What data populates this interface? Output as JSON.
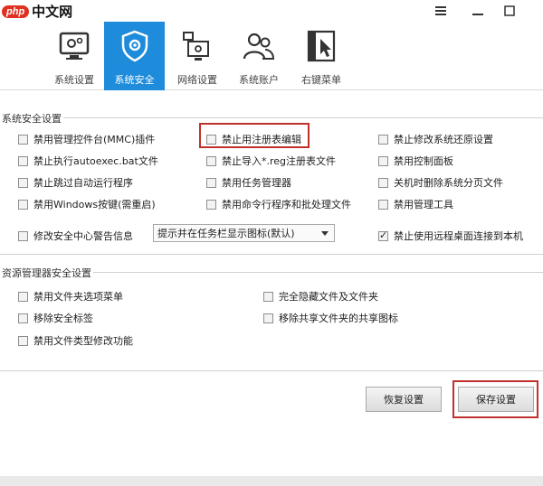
{
  "titlebar": {
    "logo_php": "php",
    "logo_cn": "中文网",
    "menu_icon": "≡",
    "minimize_icon": "—",
    "maximize_icon": "□"
  },
  "toolbar": {
    "items": [
      {
        "label": "系统设置",
        "icon": "computer-gear-icon"
      },
      {
        "label": "系统安全",
        "icon": "shield-gear-icon",
        "active": true
      },
      {
        "label": "网络设置",
        "icon": "network-icon"
      },
      {
        "label": "系统账户",
        "icon": "users-icon"
      },
      {
        "label": "右键菜单",
        "icon": "cursor-menu-icon"
      }
    ],
    "active_color": "#1e8bdb"
  },
  "system_security": {
    "title": "系统安全设置",
    "col1": [
      {
        "label": "禁用管理控件台(MMC)插件",
        "checked": false
      },
      {
        "label": "禁止执行autoexec.bat文件",
        "checked": false
      },
      {
        "label": "禁止跳过自动运行程序",
        "checked": false
      },
      {
        "label": "禁用Windows按键(需重启)",
        "checked": false
      }
    ],
    "col2": [
      {
        "label": "禁止用注册表编辑",
        "checked": false
      },
      {
        "label": "禁止导入*.reg注册表文件",
        "checked": false
      },
      {
        "label": "禁用任务管理器",
        "checked": false
      },
      {
        "label": "禁用命令行程序和批处理文件",
        "checked": false
      }
    ],
    "col3": [
      {
        "label": "禁止修改系统还原设置",
        "checked": false
      },
      {
        "label": "禁用控制面板",
        "checked": false
      },
      {
        "label": "关机时删除系统分页文件",
        "checked": false
      },
      {
        "label": "禁用管理工具",
        "checked": false
      }
    ],
    "alert_label": "修改安全中心警告信息",
    "alert_checked": false,
    "alert_select_value": "提示并在任务栏显示图标(默认)",
    "remote_label": "禁止使用远程桌面连接到本机",
    "remote_checked": true
  },
  "explorer_security": {
    "title": "资源管理器安全设置",
    "left": [
      {
        "label": "禁用文件夹选项菜单",
        "checked": false
      },
      {
        "label": "移除安全标签",
        "checked": false
      },
      {
        "label": "禁用文件类型修改功能",
        "checked": false
      }
    ],
    "right": [
      {
        "label": "完全隐藏文件及文件夹",
        "checked": false
      },
      {
        "label": "移除共享文件夹的共享图标",
        "checked": false
      }
    ]
  },
  "buttons": {
    "restore": "恢复设置",
    "save": "保存设置"
  },
  "highlight_color": "#c0312d"
}
